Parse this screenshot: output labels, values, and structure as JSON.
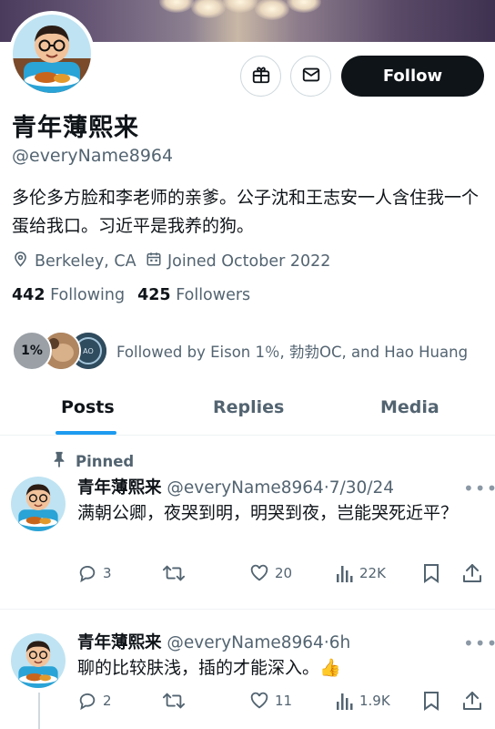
{
  "profile": {
    "name": "青年薄熙来",
    "handle": "@everyName8964",
    "bio": "多伦多方脸和李老师的亲爹。公子沈和王志安一人含住我一个蛋给我口。习近平是我养的狗。",
    "location": "Berkeley, CA",
    "joined": "Joined October 2022",
    "following_count": "442",
    "following_label": "Following",
    "followers_count": "425",
    "followers_label": "Followers",
    "followed_by": "Followed by Eison 1％, 勃勃OC, and Hao Huang",
    "mutual_badge": "1%",
    "follow_label": "Follow"
  },
  "tabs": [
    {
      "label": "Posts",
      "active": true
    },
    {
      "label": "Replies",
      "active": false
    },
    {
      "label": "Media",
      "active": false
    }
  ],
  "tweets": [
    {
      "pinned_label": "Pinned",
      "name": "青年薄熙来",
      "handle_date": "@everyName8964·7/30/24",
      "text": "满朝公卿，夜哭到明，明哭到夜，岂能哭死近平？",
      "replies": "3",
      "likes": "20",
      "views": "22K",
      "more": "•••"
    },
    {
      "name": "青年薄熙来",
      "handle_date": "@everyName8964·6h",
      "text": "聊的比较肤浅，插的才能深入。",
      "emoji": "👍",
      "replies": "2",
      "likes": "11",
      "views": "1.9K",
      "more": "•••"
    }
  ],
  "icons": {
    "gift": "gift-icon",
    "mail": "mail-icon",
    "location": "location-icon",
    "calendar": "calendar-icon",
    "pin": "pin-icon",
    "reply": "reply-icon",
    "retweet": "retweet-icon",
    "like": "heart-icon",
    "views": "views-icon",
    "bookmark": "bookmark-icon",
    "share": "share-icon"
  },
  "colors": {
    "accent": "#1d9bf0",
    "text": "#0f1419",
    "muted": "#536471",
    "follow_bg": "#0f1419"
  }
}
